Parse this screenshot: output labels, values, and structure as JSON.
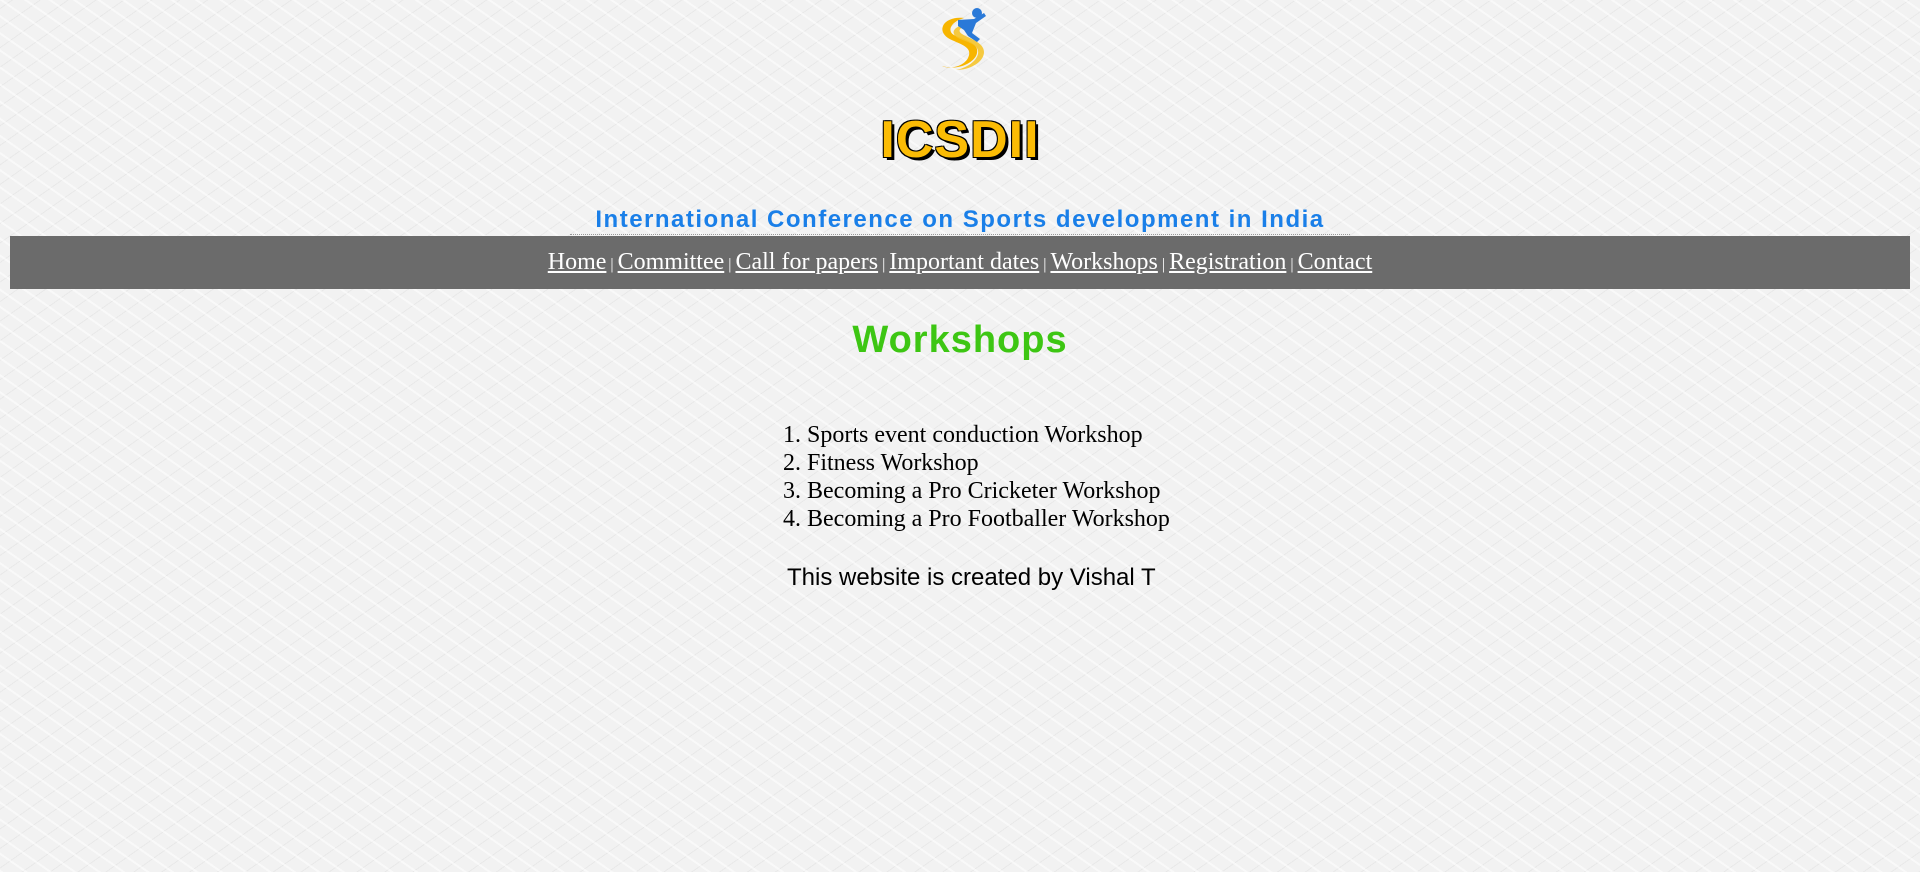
{
  "header": {
    "logo_icon": "sports-runner-logo-icon",
    "title": "ICSDII",
    "subtitle": "International Conference on Sports development in India"
  },
  "nav": {
    "separator": "|",
    "items": [
      {
        "label": "Home"
      },
      {
        "label": "Committee"
      },
      {
        "label": "Call for papers"
      },
      {
        "label": "Important dates"
      },
      {
        "label": "Workshops"
      },
      {
        "label": "Registration"
      },
      {
        "label": "Contact"
      }
    ]
  },
  "main": {
    "heading": "Workshops",
    "workshops": [
      {
        "number": "1.",
        "name": "Sports event conduction Workshop"
      },
      {
        "number": "2.",
        "name": "Fitness Workshop"
      },
      {
        "number": "3.",
        "name": "Becoming a Pro Cricketer Workshop"
      },
      {
        "number": "4.",
        "name": "Becoming a Pro Footballer Workshop"
      }
    ]
  },
  "footer": {
    "credit": "This website is created by Vishal T"
  },
  "colors": {
    "title": "#fbbc05",
    "subtitle": "#1a7fe8",
    "nav_background": "#6b6b6b",
    "heading": "#3dc613"
  }
}
